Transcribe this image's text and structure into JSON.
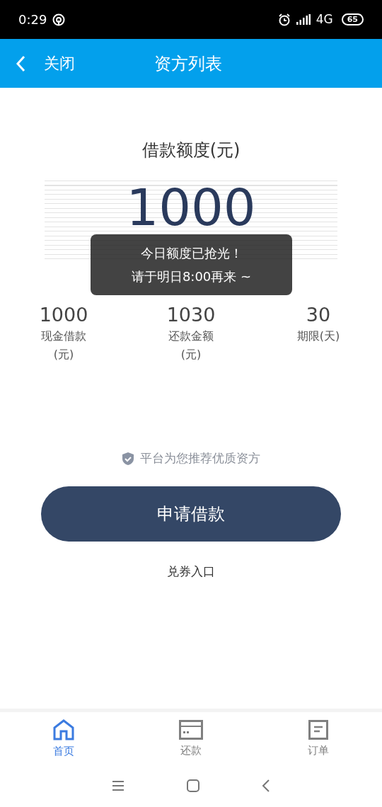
{
  "status_bar": {
    "time": "0:29",
    "network": "4G",
    "battery": "65"
  },
  "header": {
    "back_label": "关闭",
    "title": "资方列表"
  },
  "quota": {
    "title": "借款额度(元)",
    "amount": "1000"
  },
  "toast": {
    "lines": [
      "今日额度已抢光！",
      "请于明日8:00再来 ~"
    ]
  },
  "stats": [
    {
      "value": "1000",
      "label": "现金借款",
      "unit": "(元)"
    },
    {
      "value": "1030",
      "label": "还款金额",
      "unit": "(元)"
    },
    {
      "value": "30",
      "label": "期限(天)"
    }
  ],
  "note": "平台为您推荐优质资方",
  "apply_button": "申请借款",
  "coupon_link": "兑券入口",
  "tabs": [
    {
      "label": "首页",
      "selected": true,
      "kind": "home"
    },
    {
      "label": "还款",
      "selected": false,
      "kind": "card"
    },
    {
      "label": "订单",
      "selected": false,
      "kind": "order"
    }
  ]
}
